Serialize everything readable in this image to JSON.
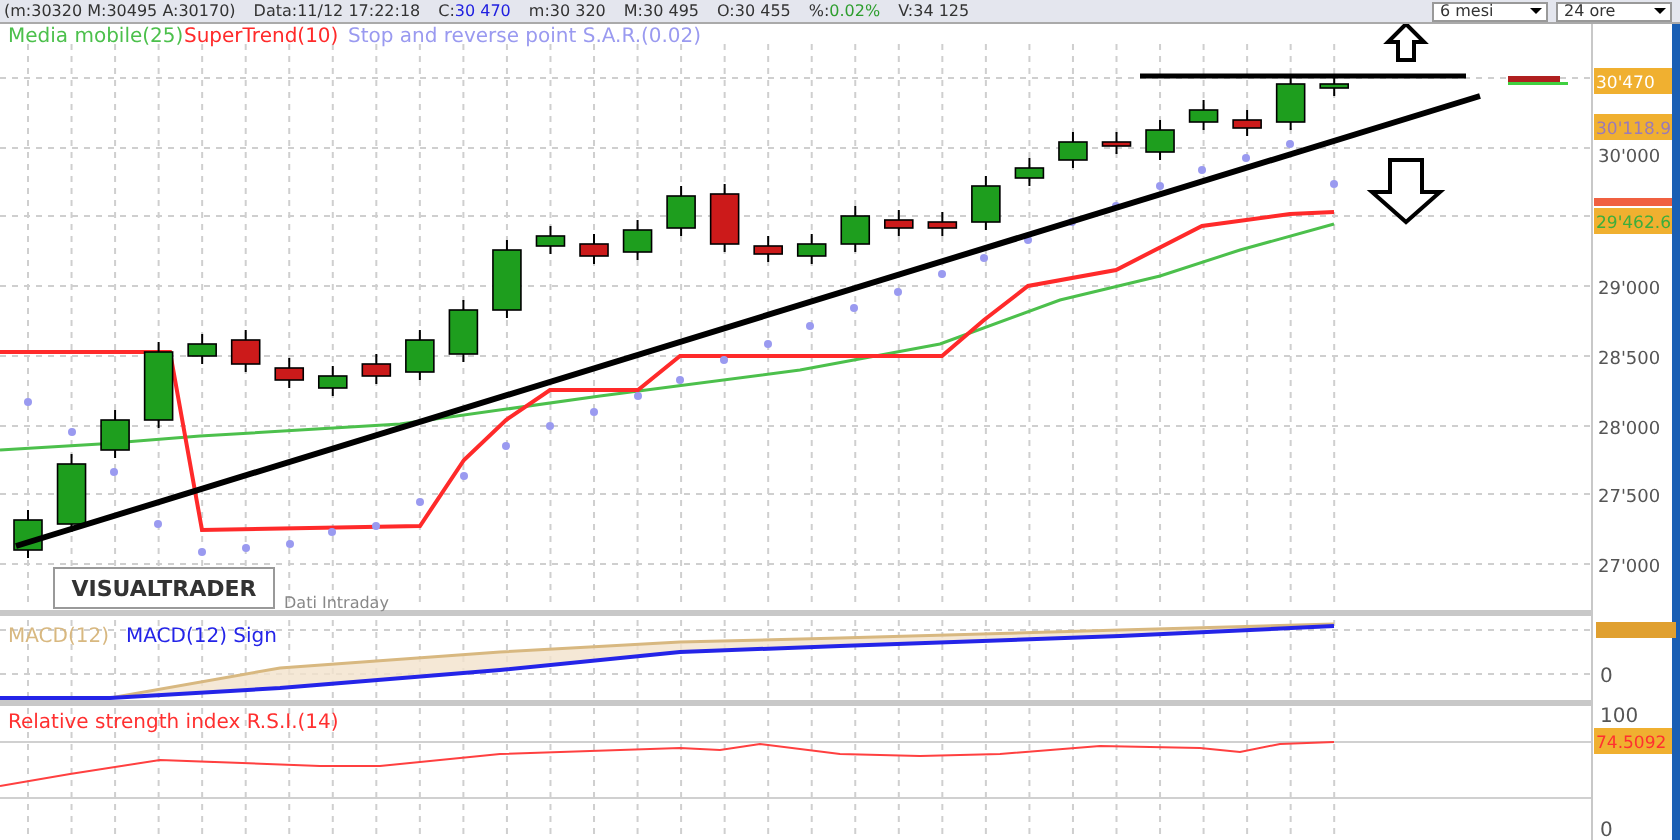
{
  "info_bar": {
    "fields": [
      {
        "label": "(m:30320 M:30495 A:30170)"
      },
      {
        "label": "Data:",
        "value": "11/12 17:22:18",
        "color": "#333333"
      },
      {
        "label": "C:",
        "value": "30 470",
        "color": "#2020e0"
      },
      {
        "label": "m:",
        "value": "30 320",
        "color": "#333333"
      },
      {
        "label": "M:",
        "value": "30 495",
        "color": "#333333"
      },
      {
        "label": "O:",
        "value": "30 455",
        "color": "#333333"
      },
      {
        "label": "%:",
        "value": "0.02%",
        "color": "#2e9e2e"
      },
      {
        "label": "V:",
        "value": "34 125",
        "color": "#333333"
      }
    ]
  },
  "period_select": {
    "value": "6 mesi"
  },
  "interval_select": {
    "value": "24 ore"
  },
  "price_panel": {
    "legend": [
      {
        "label": "Media mobile(25)",
        "color": "#4cc04c"
      },
      {
        "label": "SuperTrend(10)",
        "color": "#ff2a2a"
      },
      {
        "label": "Stop and reverse point S.A.R.(0.02)",
        "color": "#9a9af0"
      }
    ],
    "axis_labels": [
      "30'000",
      "29'000",
      "28'500",
      "28'000",
      "27'500",
      "27'000"
    ],
    "price_tags": [
      {
        "text": "30'470",
        "kind": "last"
      },
      {
        "text": "30'118.9",
        "kind": "sar"
      },
      {
        "text": "29'462.6",
        "kind": "ma"
      }
    ],
    "logo": "VISUALTRADER",
    "caption": "Dati Intraday"
  },
  "macd_panel": {
    "legend": [
      {
        "label": "MACD(12)",
        "color": "#d8b880"
      },
      {
        "label": "MACD(12) Sign",
        "color": "#2424e8"
      }
    ],
    "axis_labels": [
      "0"
    ]
  },
  "rsi_panel": {
    "title": "Relative strength index R.S.I.(14)",
    "axis_labels": [
      "100",
      "0"
    ],
    "value_tag": "74.5092"
  }
}
